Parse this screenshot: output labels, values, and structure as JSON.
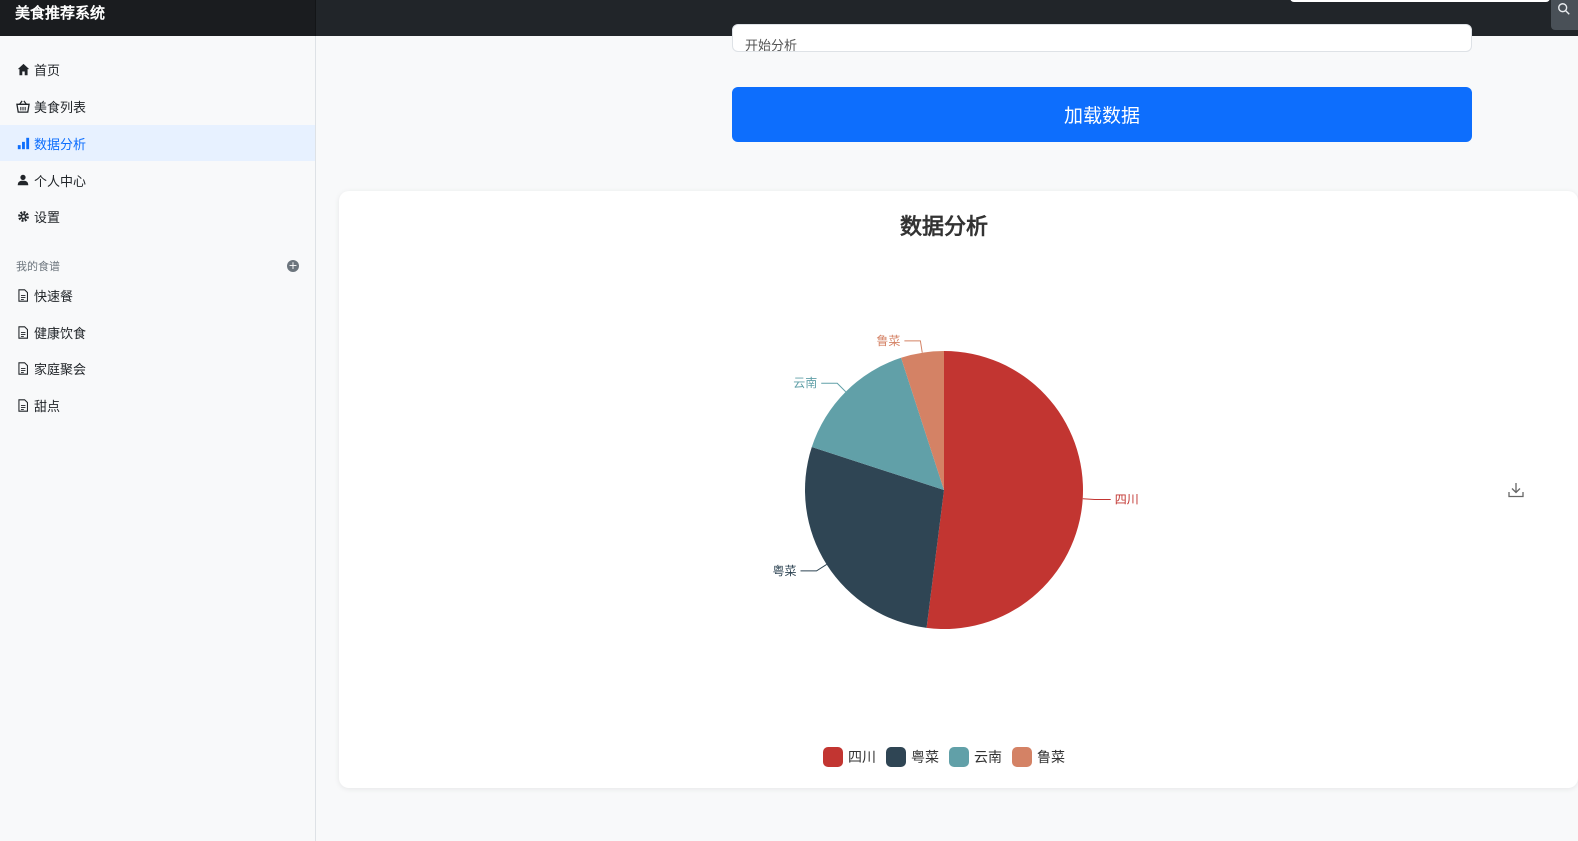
{
  "app": {
    "title": "美食推荐系统"
  },
  "topbar": {
    "search_icon": "search-icon"
  },
  "sidebar": {
    "items": [
      {
        "label": "首页",
        "icon": "home-icon"
      },
      {
        "label": "美食列表",
        "icon": "basket-icon"
      },
      {
        "label": "数据分析",
        "icon": "bar-chart-icon",
        "active": true
      },
      {
        "label": "个人中心",
        "icon": "person-icon"
      },
      {
        "label": "设置",
        "icon": "gear-icon"
      }
    ],
    "section": {
      "title": "我的食谱",
      "add_icon": "plus-circle-icon"
    },
    "recipes": [
      {
        "label": "快速餐",
        "icon": "file-icon"
      },
      {
        "label": "健康饮食",
        "icon": "file-icon"
      },
      {
        "label": "家庭聚会",
        "icon": "file-icon"
      },
      {
        "label": "甜点",
        "icon": "file-icon"
      }
    ]
  },
  "main": {
    "field_text": "开始分析",
    "load_button": "加载数据",
    "download_icon": "download-icon"
  },
  "colors": {
    "primary": "#0d6efd",
    "series": [
      "#c23531",
      "#2f4554",
      "#61a0a8",
      "#d48265"
    ]
  },
  "chart_data": {
    "type": "pie",
    "title": "数据分析",
    "categories": [
      "四川",
      "粤菜",
      "云南",
      "鲁菜"
    ],
    "values": [
      52,
      28,
      15,
      5
    ],
    "legend_position": "bottom"
  }
}
